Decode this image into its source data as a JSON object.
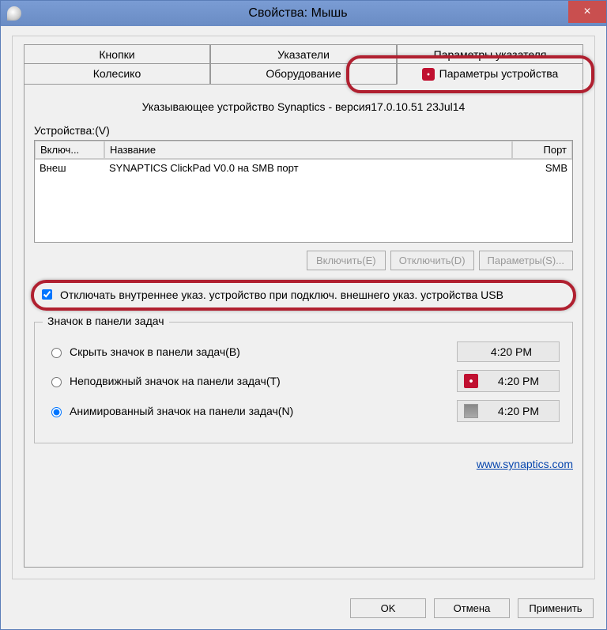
{
  "window": {
    "title": "Свойства: Мышь",
    "close_label": "×"
  },
  "tabs_row1": [
    "Кнопки",
    "Указатели",
    "Параметры указателя"
  ],
  "tabs_row2": [
    "Колесико",
    "Оборудование",
    "Параметры устройства"
  ],
  "active_tab_index": 5,
  "panel": {
    "device_heading": "Указывающее устройство Synaptics - версия17.0.10.51 23Jul14",
    "devices_label": "Устройства:(V)",
    "table": {
      "headers": {
        "enable": "Включ...",
        "name": "Название",
        "port": "Порт"
      },
      "rows": [
        {
          "enable": "Внеш",
          "name": "SYNAPTICS ClickPad V0.0 на SMB порт",
          "port": "SMB"
        }
      ]
    },
    "buttons": {
      "enable": "Включить(E)",
      "disable": "Отключить(D)",
      "settings": "Параметры(S)..."
    },
    "checkbox": {
      "checked": true,
      "label": "Отключать внутреннее указ. устройство при подключ. внешнего указ. устройства USB"
    },
    "tray_group": {
      "title": "Значок в панели задач",
      "options": [
        {
          "label": "Скрыть значок в панели задач(B)",
          "time": "4:20 PM",
          "icon": "blank"
        },
        {
          "label": "Неподвижный значок на панели задач(T)",
          "time": "4:20 PM",
          "icon": "syn"
        },
        {
          "label": "Анимированный значок на панели задач(N)",
          "time": "4:20 PM",
          "icon": "monitor"
        }
      ],
      "selected": 2
    },
    "link": "www.synaptics.com"
  },
  "footer": {
    "ok": "OK",
    "cancel": "Отмена",
    "apply": "Применить"
  }
}
